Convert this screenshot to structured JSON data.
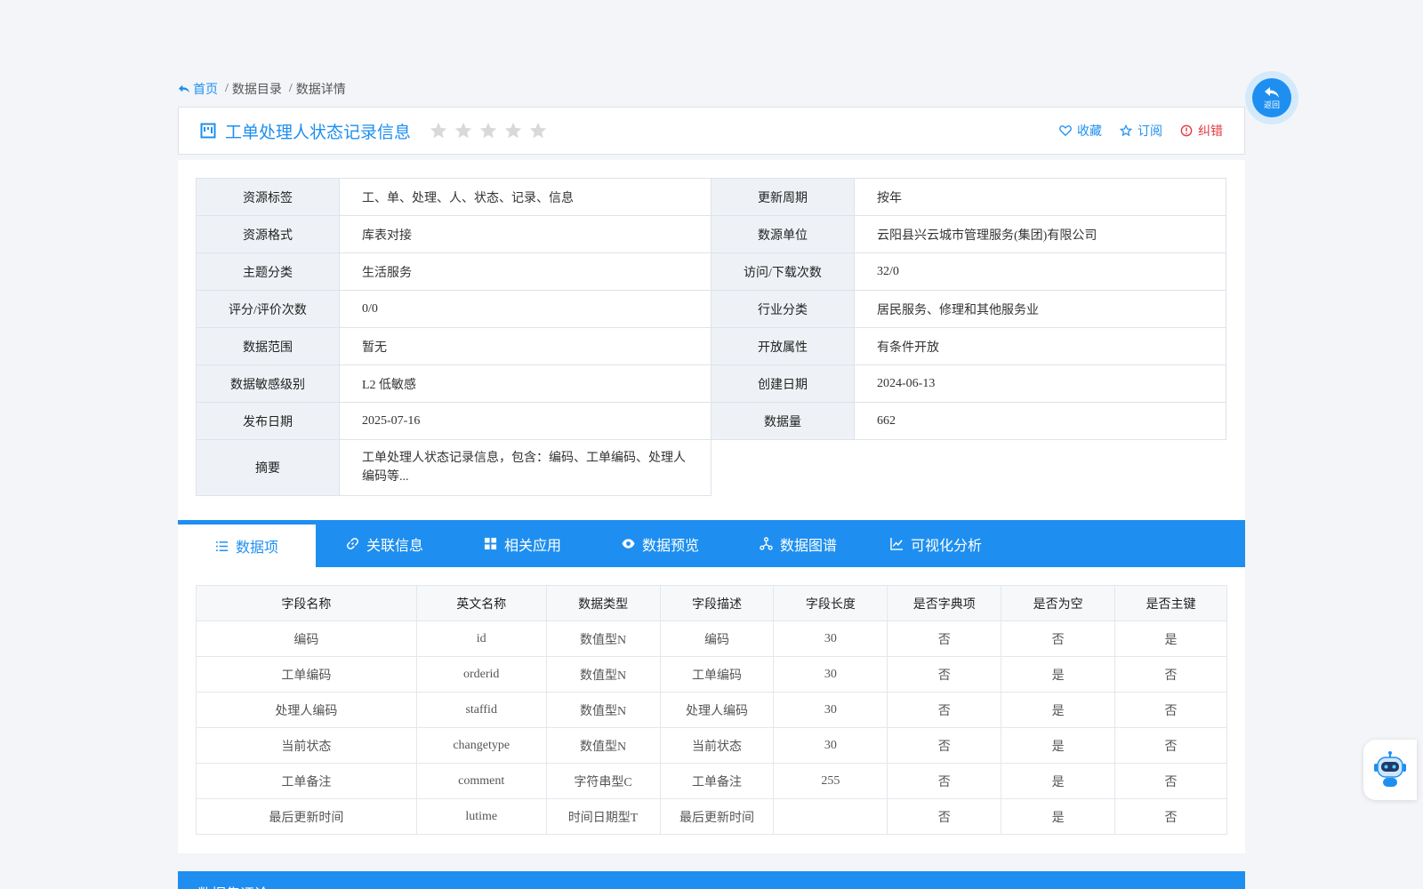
{
  "breadcrumb": {
    "home": "首页",
    "catalog": "数据目录",
    "detail": "数据详情"
  },
  "header": {
    "title": "工单处理人状态记录信息",
    "rating_stars": 0,
    "actions": {
      "favorite": "收藏",
      "subscribe": "订阅",
      "report": "纠错"
    }
  },
  "back_button": {
    "label": "返回"
  },
  "info": {
    "rows": [
      {
        "l1": "资源标签",
        "v1": "工、单、处理、人、状态、记录、信息",
        "l2": "更新周期",
        "v2": "按年"
      },
      {
        "l1": "资源格式",
        "v1": "库表对接",
        "l2": "数源单位",
        "v2": "云阳县兴云城市管理服务(集团)有限公司"
      },
      {
        "l1": "主题分类",
        "v1": "生活服务",
        "l2": "访问/下载次数",
        "v2": "32/0"
      },
      {
        "l1": "评分/评价次数",
        "v1": "0/0",
        "l2": "行业分类",
        "v2": "居民服务、修理和其他服务业"
      },
      {
        "l1": "数据范围",
        "v1": "暂无",
        "l2": "开放属性",
        "v2": "有条件开放"
      },
      {
        "l1": "数据敏感级别",
        "v1": "L2 低敏感",
        "l2": "创建日期",
        "v2": "2024-06-13"
      },
      {
        "l1": "发布日期",
        "v1": "2025-07-16",
        "l2": "数据量",
        "v2": "662"
      }
    ],
    "summary_label": "摘要",
    "summary": "工单处理人状态记录信息，包含：编码、工单编码、处理人编码等..."
  },
  "tabs": [
    "数据项",
    "关联信息",
    "相关应用",
    "数据预览",
    "数据图谱",
    "可视化分析"
  ],
  "fields": {
    "headers": [
      "字段名称",
      "英文名称",
      "数据类型",
      "字段描述",
      "字段长度",
      "是否字典项",
      "是否为空",
      "是否主键"
    ],
    "rows": [
      [
        "编码",
        "id",
        "数值型N",
        "编码",
        "30",
        "否",
        "否",
        "是"
      ],
      [
        "工单编码",
        "orderid",
        "数值型N",
        "工单编码",
        "30",
        "否",
        "是",
        "否"
      ],
      [
        "处理人编码",
        "staffid",
        "数值型N",
        "处理人编码",
        "30",
        "否",
        "是",
        "否"
      ],
      [
        "当前状态",
        "changetype",
        "数值型N",
        "当前状态",
        "30",
        "否",
        "是",
        "否"
      ],
      [
        "工单备注",
        "comment",
        "字符串型C",
        "工单备注",
        "255",
        "否",
        "是",
        "否"
      ],
      [
        "最后更新时间",
        "lutime",
        "时间日期型T",
        "最后更新时间",
        "",
        "否",
        "是",
        "否"
      ]
    ]
  },
  "bottom_section": {
    "title": "数据集评论"
  },
  "colors": {
    "primary": "#1e8ff0",
    "danger": "#e4393c",
    "label_bg": "#eef2f6"
  }
}
